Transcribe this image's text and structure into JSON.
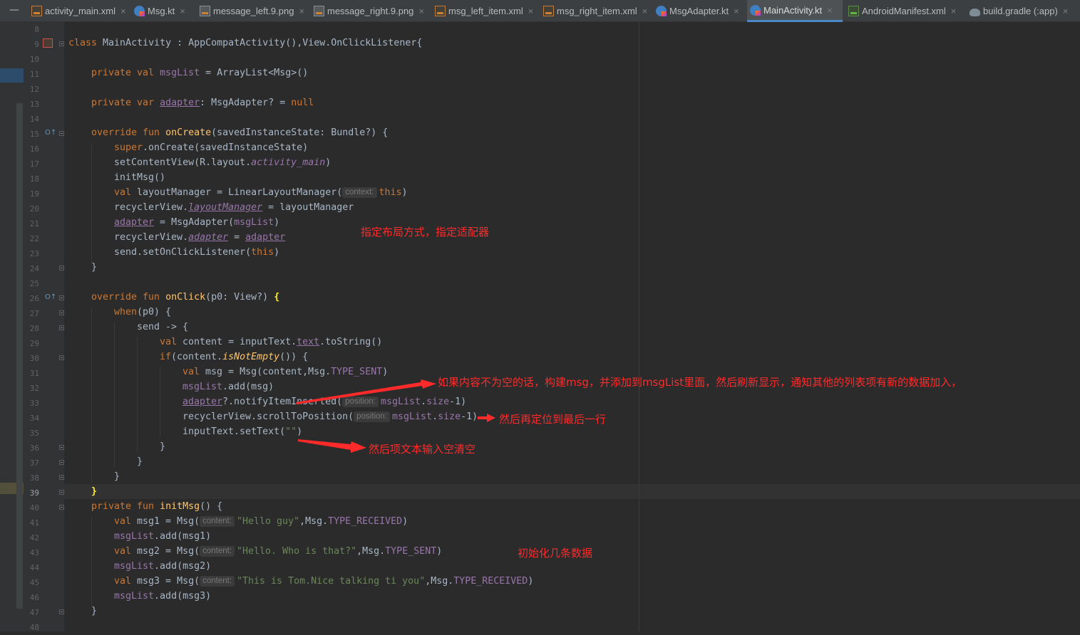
{
  "tabs": [
    {
      "label": "activity_main.xml",
      "icon": "xml-file-icon",
      "active": false
    },
    {
      "label": "Msg.kt",
      "icon": "kotlin-file-icon",
      "active": false
    },
    {
      "label": "message_left.9.png",
      "icon": "image-file-icon",
      "active": false
    },
    {
      "label": "message_right.9.png",
      "icon": "image-file-icon",
      "active": false
    },
    {
      "label": "msg_left_item.xml",
      "icon": "xml-file-icon",
      "active": false
    },
    {
      "label": "msg_right_item.xml",
      "icon": "xml-file-icon",
      "active": false
    },
    {
      "label": "MsgAdapter.kt",
      "icon": "kotlin-file-icon",
      "active": false
    },
    {
      "label": "MainActivity.kt",
      "icon": "kotlin-file-icon",
      "active": true
    },
    {
      "label": "AndroidManifest.xml",
      "icon": "manifest-file-icon",
      "active": false
    },
    {
      "label": "build.gradle (:app)",
      "icon": "gradle-file-icon",
      "active": false
    }
  ],
  "tab_close_glyph": "×",
  "minimize_glyph": "—",
  "gutter": {
    "first_line": 8,
    "last_line": 48,
    "current_line": 39
  },
  "code": {
    "l9": {
      "kw": "class",
      "name": " MainActivity : AppCompatActivity(),View.OnClickListener{"
    },
    "l11": {
      "kw": "private val ",
      "prop": "msgList",
      "rest": " = ArrayList<Msg>()"
    },
    "l13": {
      "kw": "private var ",
      "prop": "adapter",
      "rest": ": MsgAdapter? = ",
      "null_kw": "null"
    },
    "l15": {
      "kw": "override fun ",
      "fn": "onCreate",
      "rest": "(savedInstanceState: Bundle?) {"
    },
    "l16": {
      "kw": "super",
      "rest": ".onCreate(savedInstanceState)"
    },
    "l17": {
      "pre": "setContentView(R.layout.",
      "prop": "activity_main",
      "post": ")"
    },
    "l18": {
      "text": "initMsg()"
    },
    "l19": {
      "kw": "val ",
      "pre": "layoutManager = LinearLayoutManager(",
      "hint": "context:",
      "kw2": "this",
      "post": ")"
    },
    "l20": {
      "pre": "recyclerView.",
      "prop": "layoutManager",
      "post": " = layoutManager"
    },
    "l21": {
      "prop": "adapter",
      "pre": " = MsgAdapter(",
      "prop2": "msgList",
      "post": ")"
    },
    "l22": {
      "pre": "recyclerView.",
      "prop": "adapter",
      "mid": " = ",
      "prop2": "adapter"
    },
    "l23": {
      "pre": "send.setOnClickListener(",
      "kw": "this",
      "post": ")"
    },
    "l24": {
      "text": "}"
    },
    "l26": {
      "kw": "override fun ",
      "fn": "onClick",
      "rest": "(p0: View?) ",
      "brace": "{"
    },
    "l27": {
      "kw": "when",
      "rest": "(p0) {"
    },
    "l28": {
      "text": "send -> {"
    },
    "l29": {
      "kw": "val ",
      "pre": "content = inputText.",
      "prop": "text",
      "post": ".toString()"
    },
    "l30": {
      "kw": "if",
      "pre": "(content.",
      "ext": "isNotEmpty",
      "post": "()) {"
    },
    "l31": {
      "kw": "val ",
      "pre": "msg = Msg(content,Msg.",
      "prop": "TYPE_SENT",
      "post": ")"
    },
    "l32": {
      "prop": "msgList",
      "post": ".add(msg)"
    },
    "l33": {
      "prop": "adapter",
      "pre": "?.notifyItemInserted(",
      "hint": "position:",
      "prop2": "msgList",
      "mid": ".",
      "prop3": "size",
      "post": "-1)"
    },
    "l34": {
      "pre": "recyclerView.scrollToPosition(",
      "hint": "position:",
      "prop": "msgList",
      "mid": ".",
      "prop2": "size",
      "post": "-1)"
    },
    "l35": {
      "pre": "inputText.setText(",
      "str": "\"\"",
      "post": ")"
    },
    "l36": {
      "text": "}"
    },
    "l37": {
      "text": "}"
    },
    "l38": {
      "text": "}"
    },
    "l39": {
      "brace": "}"
    },
    "l40": {
      "kw": "private fun ",
      "fn": "initMsg",
      "rest": "() {"
    },
    "l41": {
      "kw": "val ",
      "pre": "msg1 = Msg(",
      "hint": "content:",
      "str": "\"Hello guy\"",
      "mid": ",Msg.",
      "prop": "TYPE_RECEIVED",
      "post": ")"
    },
    "l42": {
      "prop": "msgList",
      "post": ".add(msg1)"
    },
    "l43": {
      "kw": "val ",
      "pre": "msg2 = Msg(",
      "hint": "content:",
      "str": "\"Hello. Who is that?\"",
      "mid": ",Msg.",
      "prop": "TYPE_SENT",
      "post": ")"
    },
    "l44": {
      "prop": "msgList",
      "post": ".add(msg2)"
    },
    "l45": {
      "kw": "val ",
      "pre": "msg3 = Msg(",
      "hint": "content:",
      "str": "\"This is Tom.Nice talking ti you\"",
      "mid": ",Msg.",
      "prop": "TYPE_RECEIVED",
      "post": ")"
    },
    "l46": {
      "prop": "msgList",
      "post": ".add(msg3)"
    },
    "l47": {
      "text": "}"
    }
  },
  "annotations": {
    "layout_adapter": "指定布局方式，指定适配器",
    "add_item": "如果内容不为空的话，构建msg，并添加到msgList里面，然后刷新显示，通知其他的列表项有新的数据加入，",
    "scroll": "然后再定位到最后一行",
    "clear": "然后项文本输入空清空",
    "init": "初始化几条数据"
  },
  "colors": {
    "annotation": "#ff2a2a",
    "keyword": "#cc7832",
    "function": "#ffc66d",
    "property": "#9876aa",
    "string": "#6a8759",
    "text": "#a9b7c6"
  }
}
